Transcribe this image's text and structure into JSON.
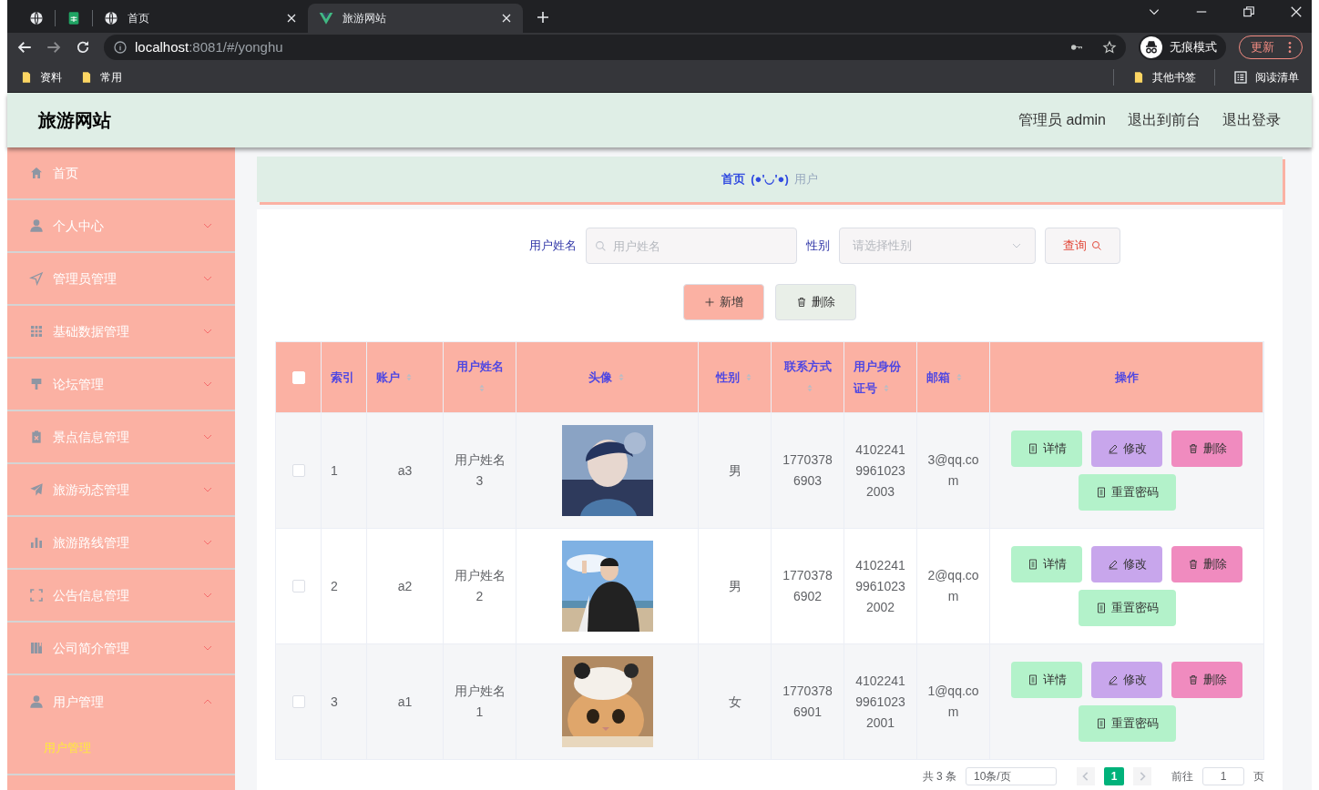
{
  "browser": {
    "tabs": [
      {
        "kind": "globe",
        "selected": false
      },
      {
        "kind": "sheet",
        "selected": false
      },
      {
        "kind": "globe",
        "title": "首页",
        "selected": false
      },
      {
        "kind": "vue",
        "title": "旅游网站",
        "selected": true
      }
    ],
    "address": {
      "host": "localhost",
      "path": ":8081/#/yonghu"
    },
    "profile": "无痕模式",
    "update": "更新",
    "bookmarks": [
      "资料",
      "常用"
    ],
    "other_bookmarks": "其他书签",
    "reading_list": "阅读清单"
  },
  "app": {
    "title": "旅游网站",
    "header_links": [
      "管理员 admin",
      "退出到前台",
      "退出登录"
    ]
  },
  "sidebar": {
    "items": [
      {
        "kind": "home",
        "label": "首页"
      },
      {
        "kind": "user",
        "label": "个人中心",
        "expanded": false
      },
      {
        "kind": "send",
        "label": "管理员管理",
        "expanded": false
      },
      {
        "kind": "grid",
        "label": "基础数据管理",
        "expanded": false
      },
      {
        "kind": "brush",
        "label": "论坛管理",
        "expanded": false
      },
      {
        "kind": "clipboard",
        "label": "景点信息管理",
        "expanded": false
      },
      {
        "kind": "plane",
        "label": "旅游动态管理",
        "expanded": false
      },
      {
        "kind": "bars",
        "label": "旅游路线管理",
        "expanded": false
      },
      {
        "kind": "scan",
        "label": "公告信息管理",
        "expanded": false
      },
      {
        "kind": "building",
        "label": "公司简介管理",
        "expanded": false
      },
      {
        "kind": "user",
        "label": "用户管理",
        "expanded": true,
        "children": [
          {
            "label": "用户管理",
            "selected": true
          }
        ]
      }
    ]
  },
  "breadcrumb": [
    {
      "label": "首页",
      "current": false
    },
    {
      "label": "(●'◡'●)",
      "current": false
    },
    {
      "label": "用户",
      "current": true
    }
  ],
  "search": {
    "fields": [
      {
        "kind": "text",
        "label": "用户姓名",
        "placeholder": "用户姓名"
      },
      {
        "kind": "select",
        "label": "性别",
        "placeholder": "请选择性别"
      }
    ],
    "button": "查询"
  },
  "toolbar": [
    {
      "kind": "add",
      "label": "新增"
    },
    {
      "kind": "delete",
      "label": "删除"
    }
  ],
  "table": {
    "select_all": {
      "checked": false
    },
    "columns": [
      {
        "label": "索引",
        "sortable": false
      },
      {
        "label": "账户",
        "sortable": true
      },
      {
        "label": "用户姓名",
        "sortable": true
      },
      {
        "label": "头像",
        "sortable": true
      },
      {
        "label": "性别",
        "sortable": true
      },
      {
        "label": "联系方式",
        "sortable": true
      },
      {
        "label": "用户身份证号",
        "sortable": true
      },
      {
        "label": "邮箱",
        "sortable": true
      },
      {
        "label": "操作",
        "sortable": false
      }
    ],
    "rows": [
      {
        "checked": false,
        "cells": [
          "1",
          "a3",
          "用户姓名3",
          {
            "kind": "picture"
          },
          "男",
          "17703786903",
          "410224199610232003",
          "3@qq.com"
        ],
        "actions": [
          {
            "kind": "detail",
            "label": "详情"
          },
          {
            "kind": "edit",
            "label": "修改"
          },
          {
            "kind": "delete",
            "label": "删除"
          },
          {
            "kind": "reset",
            "label": "重置密码"
          }
        ]
      },
      {
        "checked": false,
        "cells": [
          "2",
          "a2",
          "用户姓名2",
          {
            "kind": "picture"
          },
          "男",
          "17703786902",
          "410224199610232002",
          "2@qq.com"
        ],
        "actions": [
          {
            "kind": "detail",
            "label": "详情"
          },
          {
            "kind": "edit",
            "label": "修改"
          },
          {
            "kind": "delete",
            "label": "删除"
          },
          {
            "kind": "reset",
            "label": "重置密码"
          }
        ]
      },
      {
        "checked": false,
        "cells": [
          "3",
          "a1",
          "用户姓名1",
          {
            "kind": "picture"
          },
          "女",
          "17703786901",
          "410224199610232001",
          "1@qq.com"
        ],
        "actions": [
          {
            "kind": "detail",
            "label": "详情"
          },
          {
            "kind": "edit",
            "label": "修改"
          },
          {
            "kind": "delete",
            "label": "删除"
          },
          {
            "kind": "reset",
            "label": "重置密码"
          }
        ]
      }
    ]
  },
  "pagination": {
    "total": "共 3 条",
    "page_size": "10条/页",
    "pages": [
      {
        "label": "1",
        "selected": true
      }
    ],
    "goto": "前往",
    "goto_value": "1",
    "page_unit": "页"
  }
}
